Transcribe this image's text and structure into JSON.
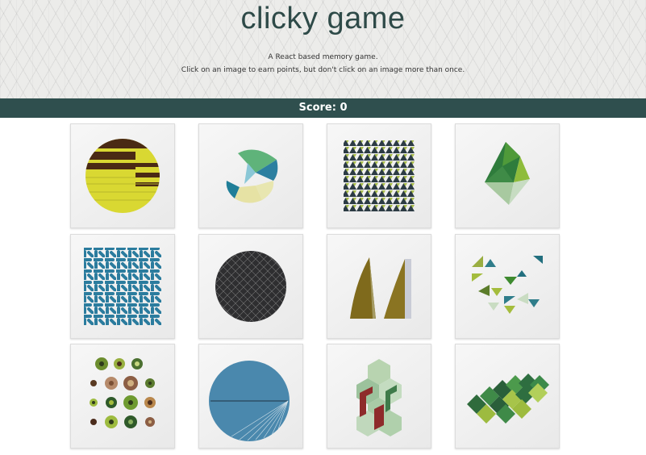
{
  "header": {
    "title": "clicky game",
    "description_line1": "A React based memory game.",
    "description_line2": "Click on an image to earn points, but don't click on an image more than once."
  },
  "score": {
    "label": "Score: 0"
  },
  "cards": [
    {
      "icon": "yellow-brown-striped-circle-art"
    },
    {
      "icon": "teal-green-fragment-circle-art"
    },
    {
      "icon": "triangle-grid-pattern-art"
    },
    {
      "icon": "green-crystal-polygon-art"
    },
    {
      "icon": "blue-maze-lines-art"
    },
    {
      "icon": "dark-grid-circle-art"
    },
    {
      "icon": "olive-sails-art"
    },
    {
      "icon": "scattered-triangles-art"
    },
    {
      "icon": "concentric-dots-art"
    },
    {
      "icon": "blue-circle-lines-art"
    },
    {
      "icon": "hexagon-cubes-art"
    },
    {
      "icon": "green-diamond-tiles-art"
    }
  ],
  "colors": {
    "title": "#2e4a48",
    "scorebar": "#2f4f4e"
  }
}
